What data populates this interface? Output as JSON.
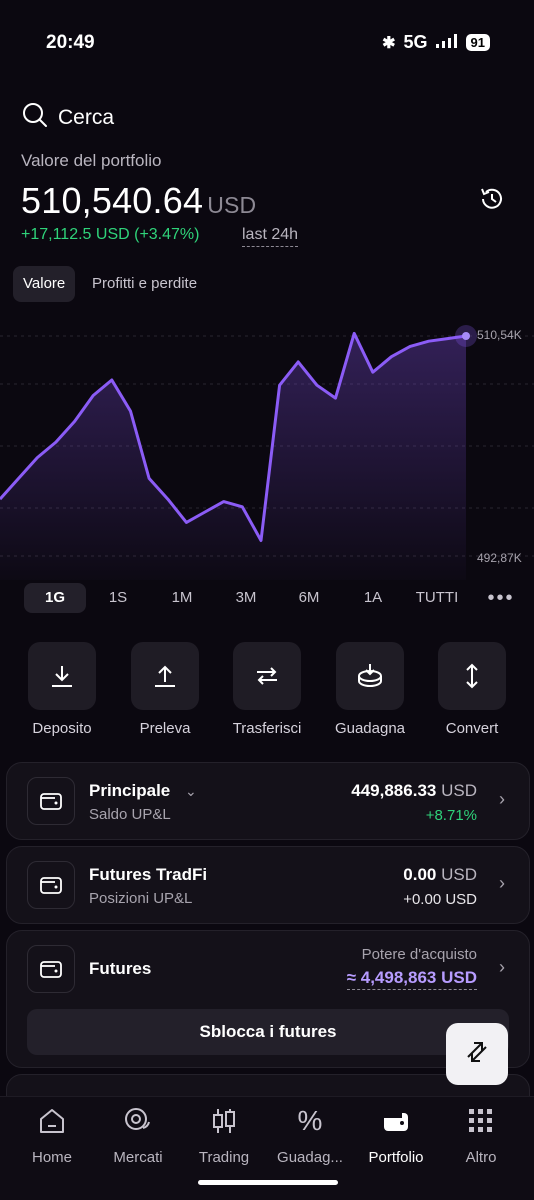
{
  "status_bar": {
    "time": "20:49",
    "network": "5G",
    "battery": "91"
  },
  "search": {
    "placeholder": "Cerca"
  },
  "portfolio": {
    "label": "Valore del portfolio",
    "value": "510,540.64",
    "currency": "USD",
    "change": "+17,112.5 USD (+3.47%)",
    "period": "last 24h"
  },
  "tabs": [
    "Valore",
    "Profitti e perdite"
  ],
  "chart": {
    "max_label": "510,54K",
    "min_label": "492,87K",
    "line_color": "#8b5cf6",
    "points": [
      0.22,
      0.3,
      0.38,
      0.44,
      0.52,
      0.62,
      0.68,
      0.56,
      0.3,
      0.22,
      0.13,
      0.17,
      0.21,
      0.19,
      0.06,
      0.66,
      0.75,
      0.66,
      0.61,
      0.86,
      0.71,
      0.77,
      0.81,
      0.83,
      0.84,
      0.85
    ]
  },
  "ranges": [
    "1G",
    "1S",
    "1M",
    "3M",
    "6M",
    "1A",
    "TUTTI"
  ],
  "active_range": "1G",
  "actions": [
    {
      "label": "Deposito",
      "icon": "download-icon"
    },
    {
      "label": "Preleva",
      "icon": "upload-icon"
    },
    {
      "label": "Trasferisci",
      "icon": "transfer-icon"
    },
    {
      "label": "Guadagna",
      "icon": "earn-icon"
    },
    {
      "label": "Convert",
      "icon": "convert-icon"
    }
  ],
  "accounts": {
    "principale": {
      "title": "Principale",
      "subtitle": "Saldo UP&L",
      "amount": "449,886.33",
      "currency": "USD",
      "change": "+8.71%"
    },
    "tradfi": {
      "title": "Futures TradFi",
      "subtitle": "Posizioni UP&L",
      "amount": "0.00",
      "currency": "USD",
      "change": "+0.00 USD"
    },
    "futures": {
      "title": "Futures",
      "buying_power_label": "Potere d'acquisto",
      "buying_power": "≈ 4,498,863 USD",
      "unlock_button": "Sblocca i futures"
    }
  },
  "colors": {
    "positive": "#2fd37a",
    "accent": "#8b5cf6",
    "background": "#0b0810"
  },
  "nav": [
    {
      "label": "Home",
      "icon": "home-icon"
    },
    {
      "label": "Mercati",
      "icon": "markets-icon"
    },
    {
      "label": "Trading",
      "icon": "trading-icon"
    },
    {
      "label": "Guadag...",
      "icon": "percent-icon"
    },
    {
      "label": "Portfolio",
      "icon": "wallet-icon"
    },
    {
      "label": "Altro",
      "icon": "more-icon"
    }
  ]
}
